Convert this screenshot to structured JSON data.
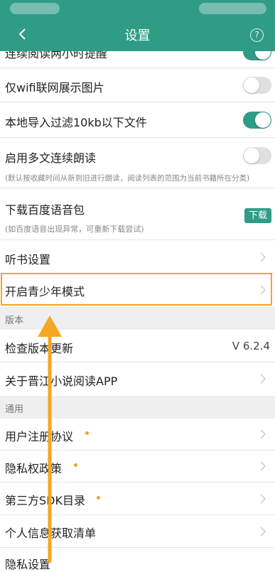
{
  "header": {
    "title": "设置"
  },
  "rows": {
    "partial_top": "连续阅读两小时提醒",
    "wifi_images": "仅wifi联网展示图片",
    "filter_10kb": "本地导入过滤10kb以下文件",
    "multi_read": "启用多文连续朗读",
    "multi_read_desc": "(默认按收藏时间从新到旧进行朗读，阅读列表的范围为当前书籍所在分类)",
    "baidu_voice": "下载百度语音包",
    "baidu_voice_desc": "(如百度语音出现异常，可重新下载尝试)",
    "baidu_voice_button": "下载",
    "listen_settings": "听书设置",
    "teen_mode": "开启青少年模式"
  },
  "section_version": {
    "title": "版本",
    "check_update": "检查版本更新",
    "version_value": "V 6.2.4",
    "about": "关于晋江小说阅读APP"
  },
  "section_general": {
    "title": "通用",
    "user_agreement": "用户注册协议",
    "privacy_policy": "隐私权政策",
    "sdk_list": "第三方SDK目录",
    "personal_info": "个人信息获取清单",
    "privacy_settings": "隐私设置"
  },
  "toggles": {
    "partial_top": true,
    "wifi_images": false,
    "filter_10kb": true,
    "multi_read": false
  },
  "colors": {
    "brand_green": "#2f9c86",
    "highlight_orange": "#f5a623",
    "dot_orange": "#f0a030"
  },
  "icons": [
    "back-arrow-icon",
    "help-icon",
    "chevron-right-icon"
  ]
}
